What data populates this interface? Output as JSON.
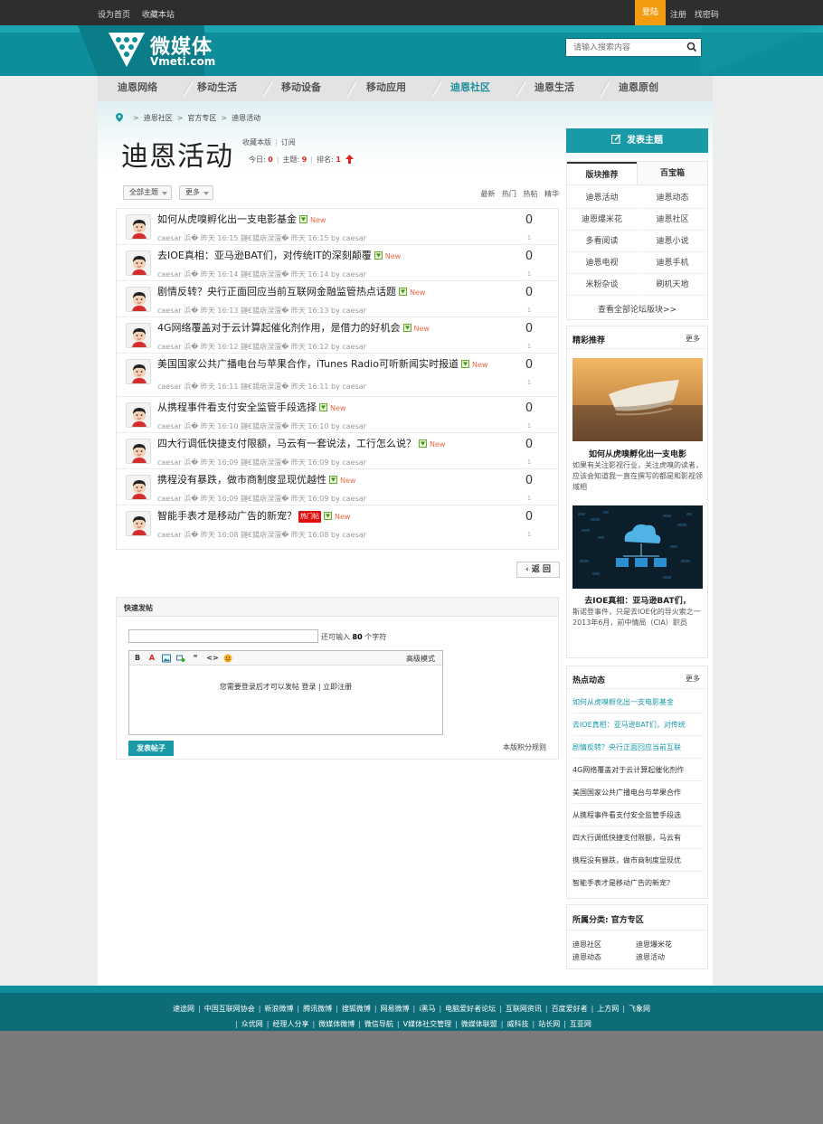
{
  "topbar": {
    "set_home": "设为首页",
    "bookmark": "收藏本站",
    "login": "登陆",
    "register": "注册",
    "find_password": "找密码"
  },
  "logo": {
    "cn": "微媒体",
    "en": "Vmeti.com"
  },
  "search": {
    "placeholder": "请输入搜索内容",
    "icon": "search-icon"
  },
  "nav": [
    "迪恩网络",
    "移动生活",
    "移动设备",
    "移动应用",
    "迪恩社区",
    "迪恩生活",
    "迪恩原创"
  ],
  "nav_active": "迪恩社区",
  "breadcrumb": [
    "迪恩社区",
    "官方专区",
    "迪恩活动"
  ],
  "forum": {
    "title": "迪恩活动",
    "fav": "收藏本版",
    "subscribe": "订阅",
    "today_label": "今日:",
    "today": "0",
    "topics_label": "主题:",
    "topics": "9",
    "rank_label": "排名:",
    "rank": "1"
  },
  "filter": {
    "all_topics": "全部主题",
    "more": "更多",
    "orders": [
      "最新",
      "热门",
      "热帖",
      "精华"
    ]
  },
  "threads": [
    {
      "title": "如何从虎嗅孵化出一支电影基金",
      "new": "New",
      "hot": "",
      "meta": "caesar 浜� 昨天 16:15 鏈€鍚庡洖澶� 昨天 16:15 by caesar",
      "replies": "0",
      "views": "1"
    },
    {
      "title": "去IOE真相：亚马逊BAT们，对传统IT的深刻颠覆",
      "new": "New",
      "hot": "",
      "meta": "caesar 浜� 昨天 16:14 鏈€鍚庡洖澶� 昨天 16:14 by caesar",
      "replies": "0",
      "views": "1"
    },
    {
      "title": "剧情反转？央行正面回应当前互联网金融监管热点话题",
      "new": "New",
      "hot": "",
      "meta": "caesar 浜� 昨天 16:13 鏈€鍚庡洖澶� 昨天 16:13 by caesar",
      "replies": "0",
      "views": "1"
    },
    {
      "title": "4G网络覆盖对于云计算起催化剂作用，是借力的好机会",
      "new": "New",
      "hot": "",
      "meta": "caesar 浜� 昨天 16:12 鏈€鍚庡洖澶� 昨天 16:12 by caesar",
      "replies": "0",
      "views": "1"
    },
    {
      "title": "美国国家公共广播电台与苹果合作，iTunes Radio可听新闻实时报道",
      "new": "New",
      "hot": "",
      "meta": "caesar 浜� 昨天 16:11 鏈€鍚庡洖澶� 昨天 16:11 by caesar",
      "replies": "0",
      "views": "1"
    },
    {
      "title": "从携程事件看支付安全监管手段选择",
      "new": "New",
      "hot": "",
      "meta": "caesar 浜� 昨天 16:10 鏈€鍚庡洖澶� 昨天 16:10 by caesar",
      "replies": "0",
      "views": "1"
    },
    {
      "title": "四大行调低快捷支付限额，马云有一套说法，工行怎么说？",
      "new": "New",
      "hot": "",
      "meta": "caesar 浜� 昨天 16:09 鏈€鍚庡洖澶� 昨天 16:09 by caesar",
      "replies": "0",
      "views": "1"
    },
    {
      "title": "携程没有暴跌，做市商制度显现优越性",
      "new": "New",
      "hot": "",
      "meta": "caesar 浜� 昨天 16:09 鏈€鍚庡洖澶� 昨天 16:09 by caesar",
      "replies": "0",
      "views": "1"
    },
    {
      "title": "智能手表才是移动广告的新宠？",
      "new": "New",
      "hot": "热门帖",
      "meta": "caesar 浜� 昨天 16:08 鏈€鍚庡洖澶� 昨天 16:08 by caesar",
      "replies": "0",
      "views": "1"
    }
  ],
  "back": "返 回",
  "quickpost": {
    "title": "快速发帖",
    "remain_prefix": "还可输入",
    "remain_num": "80",
    "remain_suffix": "个字符",
    "tools": [
      "B",
      "A",
      "image-icon",
      "link-icon",
      "“",
      "<>",
      "smiley-icon"
    ],
    "advanced": "高级模式",
    "need_login": "您需要登录后才可以发帖",
    "login_link": "登录",
    "register_link": "立即注册",
    "submit": "发表帖子",
    "rules": "本版积分规则"
  },
  "sidebar": {
    "post_button": "发表主题",
    "tab_boards": "版块推荐",
    "tab_baike": "百宝箱",
    "boards": [
      "迪恩活动",
      "迪恩动态",
      "迪恩爆米花",
      "迪恩社区",
      "多看阅读",
      "迪恩小说",
      "迪恩电视",
      "迪恩手机",
      "米粉杂谈",
      "刷机天地"
    ],
    "view_all": "查看全部论坛版块>>",
    "featured_title": "精彩推荐",
    "more": "更多",
    "featured": [
      {
        "title": "如何从虎嗅孵化出一支电影",
        "desc": "如果有关注影视行业，关注虎嗅的读者，应该会知道我一直在撰写的都是和影视领域相"
      },
      {
        "title": "去IOE真相：亚马逊BAT们，",
        "desc": "斯诺登事件，只是去IOE化的导火索之一 2013年6月，前中情局（CIA）职员"
      }
    ],
    "hot_title": "热点动态",
    "hot_items": [
      "如何从虎嗅孵化出一支电影基金",
      "去IOE真相：亚马逊BAT们，对传统",
      "剧情反转？央行正面回应当前互联",
      "4G网络覆盖对于云计算起催化剂作",
      "美国国家公共广播电台与苹果合作",
      "从携程事件看支付安全监管手段选",
      "四大行调低快捷支付限额，马云有",
      "携程没有暴跌，做市商制度显现优",
      "智能手表才是移动广告的新宠？"
    ],
    "category_title": "所属分类: 官方专区",
    "categories": [
      "迪恩社区",
      "迪恩爆米花",
      "迪恩动态",
      "迪恩活动"
    ]
  },
  "footer": {
    "row1": [
      "速途网",
      "中国互联网协会",
      "新浪微博",
      "腾讯微博",
      "搜狐微博",
      "网易微博",
      "i黑马",
      "电脑爱好者论坛",
      "互联网资讯",
      "百度爱好者",
      "上方网",
      "飞象网"
    ],
    "row2": [
      "众优网",
      "经理人分享",
      "微媒体微博",
      "微信导航",
      "V媒体社交管理",
      "微媒体联盟",
      "威科技",
      "站长网",
      "互亚网"
    ]
  },
  "colors": {
    "brand": "#0e8e9b",
    "accent": "#1a9aa6",
    "login_bg": "#f39c12",
    "new_tag": "#e96b47",
    "hot_tag": "#dd1111"
  }
}
